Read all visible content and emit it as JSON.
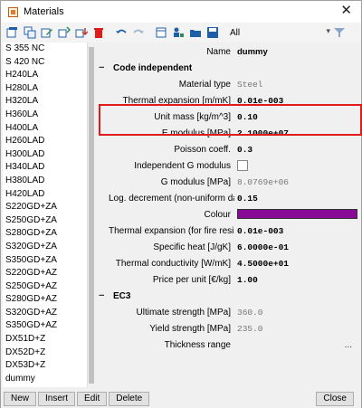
{
  "window": {
    "title": "Materials",
    "close_glyph": "✕"
  },
  "toolbar": {
    "filter_label": "All",
    "icons": [
      "new-icon",
      "copy-icon",
      "edit-icon",
      "import-icon",
      "export-icon",
      "delete-icon",
      "undo-icon",
      "redo-icon",
      "database-icon",
      "users-icon",
      "open-icon",
      "save-icon",
      "filter-icon"
    ]
  },
  "materials": [
    "S 355 NC",
    "S 420 NC",
    "H240LA",
    "H280LA",
    "H320LA",
    "H360LA",
    "H400LA",
    "H260LAD",
    "H300LAD",
    "H340LAD",
    "H380LAD",
    "H420LAD",
    "S220GD+ZA",
    "S250GD+ZA",
    "S280GD+ZA",
    "S320GD+ZA",
    "S350GD+ZA",
    "S220GD+AZ",
    "S250GD+AZ",
    "S280GD+AZ",
    "S320GD+AZ",
    "S350GD+AZ",
    "DX51D+Z",
    "DX52D+Z",
    "DX53D+Z",
    "dummy"
  ],
  "properties": {
    "name_label": "Name",
    "name_value": "dummy",
    "section1": "Code independent",
    "material_type_label": "Material type",
    "material_type_value": "Steel",
    "thermal_exp_label": "Thermal expansion  [m/mK]",
    "thermal_exp_value": "0.01e-003",
    "unit_mass_label": "Unit mass [kg/m^3]",
    "unit_mass_value": "0.10",
    "e_modulus_label": "E modulus [MPa]",
    "e_modulus_value": "2.1000e+07",
    "poisson_label": "Poisson coeff.",
    "poisson_value": "0.3",
    "indep_g_label": "Independent G modulus",
    "g_modulus_label": "G modulus [MPa]",
    "g_modulus_value": "8.0769e+06",
    "log_dec_label": "Log. decrement (non-uniform da",
    "log_dec_value": "0.15",
    "colour_label": "Colour",
    "colour_hex": "#8a0a98",
    "thermal_fire_label": "Thermal expansion (for fire resis",
    "thermal_fire_value": "0.01e-003",
    "specific_heat_label": "Specific heat [J/gK]",
    "specific_heat_value": "6.0000e-01",
    "thermal_cond_label": "Thermal conductivity [W/mK]",
    "thermal_cond_value": "4.5000e+01",
    "price_label": "Price per unit [€/kg]",
    "price_value": "1.00",
    "section2": "EC3",
    "ultimate_label": "Ultimate strength [MPa]",
    "ultimate_value": "360.0",
    "yield_label": "Yield strength [MPa]",
    "yield_value": "235.0",
    "thickness_label": "Thickness range",
    "thickness_ellipsis": "..."
  },
  "buttons": {
    "new": "New",
    "insert": "Insert",
    "edit": "Edit",
    "delete": "Delete",
    "close": "Close"
  },
  "colors": {
    "highlight": "#e11b1b",
    "swatch": "#8a0a98"
  }
}
